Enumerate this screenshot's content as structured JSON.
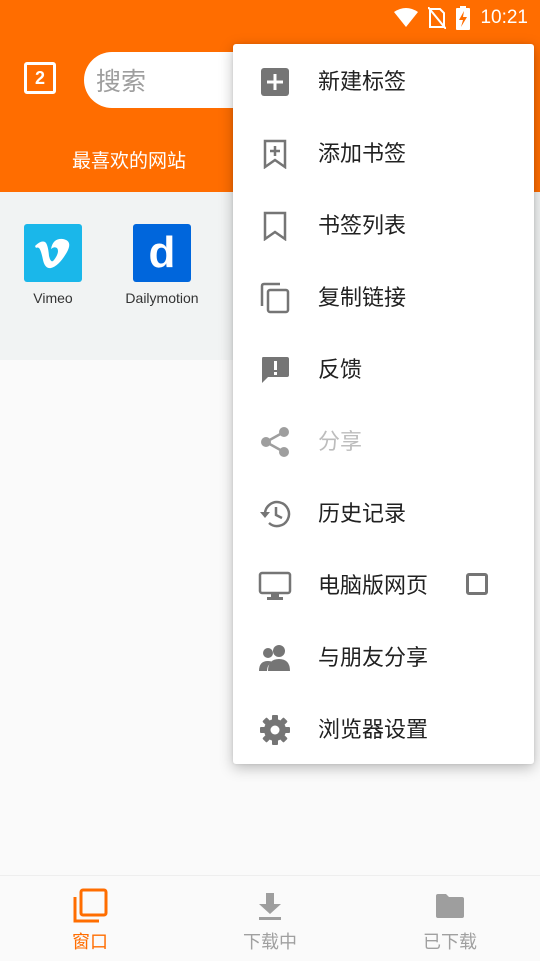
{
  "status_bar": {
    "time": "10:21",
    "icons": [
      "wifi-icon",
      "no-sim-icon",
      "battery-charging-icon"
    ]
  },
  "toolbar": {
    "tab_count": "2",
    "search_placeholder": "搜索",
    "accent": "#ff6d00"
  },
  "favorites": {
    "title": "最喜欢的网站",
    "sites": [
      {
        "name": "Vimeo",
        "icon": "vimeo-logo",
        "color": "#1ab7ea"
      },
      {
        "name": "Dailymotion",
        "icon": "dailymotion-logo",
        "color": "#0066dc",
        "glyph": "d"
      }
    ]
  },
  "menu": {
    "items": [
      {
        "label": "新建标签",
        "icon": "add-box-icon"
      },
      {
        "label": "添加书签",
        "icon": "bookmark-add-icon"
      },
      {
        "label": "书签列表",
        "icon": "bookmark-icon"
      },
      {
        "label": "复制链接",
        "icon": "copy-icon"
      },
      {
        "label": "反馈",
        "icon": "feedback-icon"
      },
      {
        "label": "分享",
        "icon": "share-icon",
        "disabled": true
      },
      {
        "label": "历史记录",
        "icon": "history-icon"
      },
      {
        "label": "电脑版网页",
        "icon": "desktop-icon",
        "checkbox": false
      },
      {
        "label": "与朋友分享",
        "icon": "people-icon"
      },
      {
        "label": "浏览器设置",
        "icon": "settings-gear-icon"
      }
    ]
  },
  "bottom_nav": {
    "tabs": [
      {
        "label": "窗口",
        "icon": "windows-icon",
        "active": true
      },
      {
        "label": "下载中",
        "icon": "download-icon"
      },
      {
        "label": "已下载",
        "icon": "folder-icon"
      }
    ]
  }
}
